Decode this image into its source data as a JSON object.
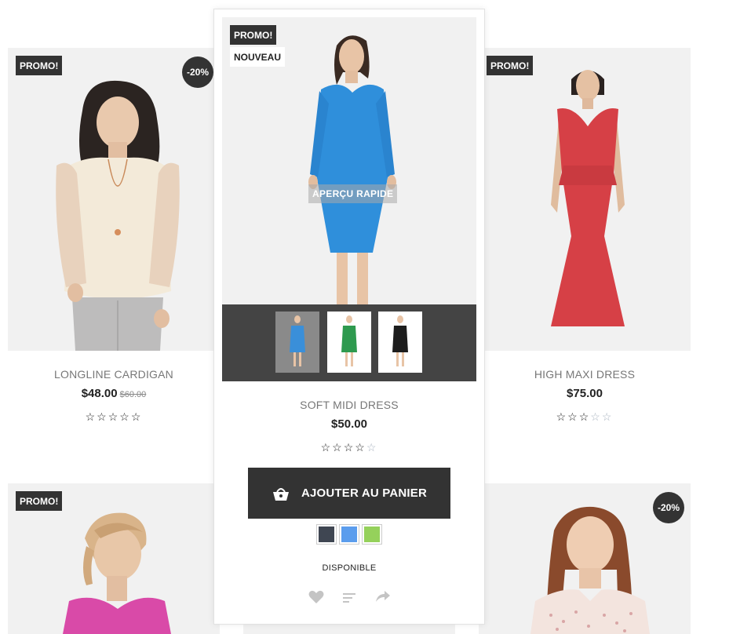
{
  "products": {
    "cardigan": {
      "badge_promo": "PROMO!",
      "badge_discount": "-20%",
      "name": "LONGLINE CARDIGAN",
      "price": "$48.00",
      "old_price": "$60.00",
      "rating": 0
    },
    "featured": {
      "badge_promo": "PROMO!",
      "badge_new": "NOUVEAU",
      "quick_view": "APERÇU RAPIDE",
      "name": "SOFT MIDI DRESS",
      "price": "$50.00",
      "rating": 4,
      "add_to_cart": "AJOUTER AU PANIER",
      "availability": "DISPONIBLE",
      "swatches": [
        "#3f4652",
        "#5b9ded",
        "#95d15b"
      ],
      "thumb_colors": [
        "#3a8fd9",
        "#2e9a4f",
        "#1d1d1d"
      ]
    },
    "maxi": {
      "badge_promo": "PROMO!",
      "name": "HIGH MAXI DRESS",
      "price": "$75.00",
      "rating": 3
    },
    "bottom_left": {
      "badge_promo": "PROMO!"
    },
    "bottom_right": {
      "badge_discount": "-20%"
    }
  },
  "icons": [
    "shopping-bag-icon",
    "heart-icon",
    "compare-icon",
    "share-icon"
  ],
  "colors": {
    "dark": "#333333",
    "card_bg": "#f1f1f1",
    "blue_dress": "#2f8fdb",
    "red_dress": "#d64046",
    "pink_top": "#d94aa8"
  }
}
